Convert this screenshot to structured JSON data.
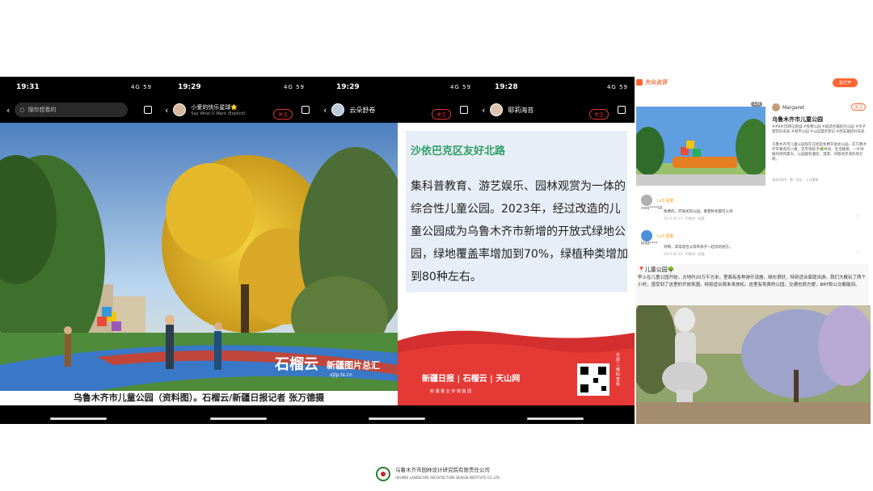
{
  "phones": [
    {
      "time": "19:31",
      "network": "4G",
      "battery": "59"
    },
    {
      "time": "19:29",
      "network": "4G",
      "battery": "59"
    },
    {
      "time": "19:29",
      "network": "4G",
      "battery": "59"
    },
    {
      "time": "19:28",
      "network": "4G",
      "battery": "59"
    }
  ],
  "search": {
    "placeholder": "搜你想看的"
  },
  "author1": {
    "name": "小爱的快乐星球🌟",
    "sub": "Say What U Want (Explicit)"
  },
  "author2": {
    "name": "云朵舒卷"
  },
  "author3": {
    "name": "耶莉海苔"
  },
  "follow_label": "关注",
  "photo_watermark": {
    "brand": "石榴云",
    "channel": "新疆图片总汇",
    "url": "xjtp.ts.cn"
  },
  "caption": "乌鲁木齐市儿童公园（资料图）。石榴云/新疆日报记者 张万德摄",
  "text_card": {
    "title": "沙依巴克区友好北路",
    "body": "集科普教育、游艺娱乐、园林观赏为一体的综合性儿童公园。2023年，经过改造的儿童公园成为乌鲁木齐市新增的开放式绿地公园，绿地覆盖率增加到70%，绿植种类增加到80种左右。"
  },
  "banner": {
    "brands": "新疆日报 | 石榴云 | 天山网",
    "sub": "新 疆 报 业 传 媒 集 团",
    "qr_label": "长按二维码查看"
  },
  "dianping": {
    "app": "大众点评",
    "open": "去打开",
    "counter": "1/8",
    "user": "Margaret",
    "follow": "关注",
    "title": "乌鲁木齐市儿童公园",
    "tags": "##8岁玩转这座城 #免费公园 #超适合遛娃的公园 #亲子游玩好去处 #城市公园 #公园漫步游记 #周末遛娃好去处",
    "desc": "乌鲁木齐市儿童公园现在已经是免费开放式公园，在乌鲁木齐市著名的八楼，还带领孩子🌿共同，生活趣意，一片绿植的地到夏天，公园都有遛娃、漫游、间歇地步道的地方呢。",
    "views": "浏览1920 · 赞 · 评论 · 上月更新",
    "comments": [
      {
        "user": "xwq****56",
        "level": "Lv3 回复",
        "text": "免费的，开放式的公园，春夏秋冬都可入场",
        "meta": "2023-06-10 · IP属地：新疆"
      },
      {
        "user": "M48****",
        "level": "Lv3 回复",
        "text": "对啊，非常适合父母带孩子一起玩的地方。",
        "meta": "2023-06-10 · IP属地：新疆"
      }
    ],
    "section_title": "📍儿童公园🌳",
    "section_body": "早上在儿童公园开始，占地约20万平方米，里面有各种游乐设施，绿化很好，特别适合家庭出游。我们大概玩了两个小时，感受到了这里的开放氛围，特别适合周末来放松。这里有免费的公园，交通也很方便，BRT和公交都能到。"
  },
  "footer": {
    "name": "乌鲁木齐市园林设计研究院有限责任公司",
    "en": "URUMQI LANDSCAPE ARCHITECTURE DESIGN INSTITUTE CO.,LTD"
  }
}
